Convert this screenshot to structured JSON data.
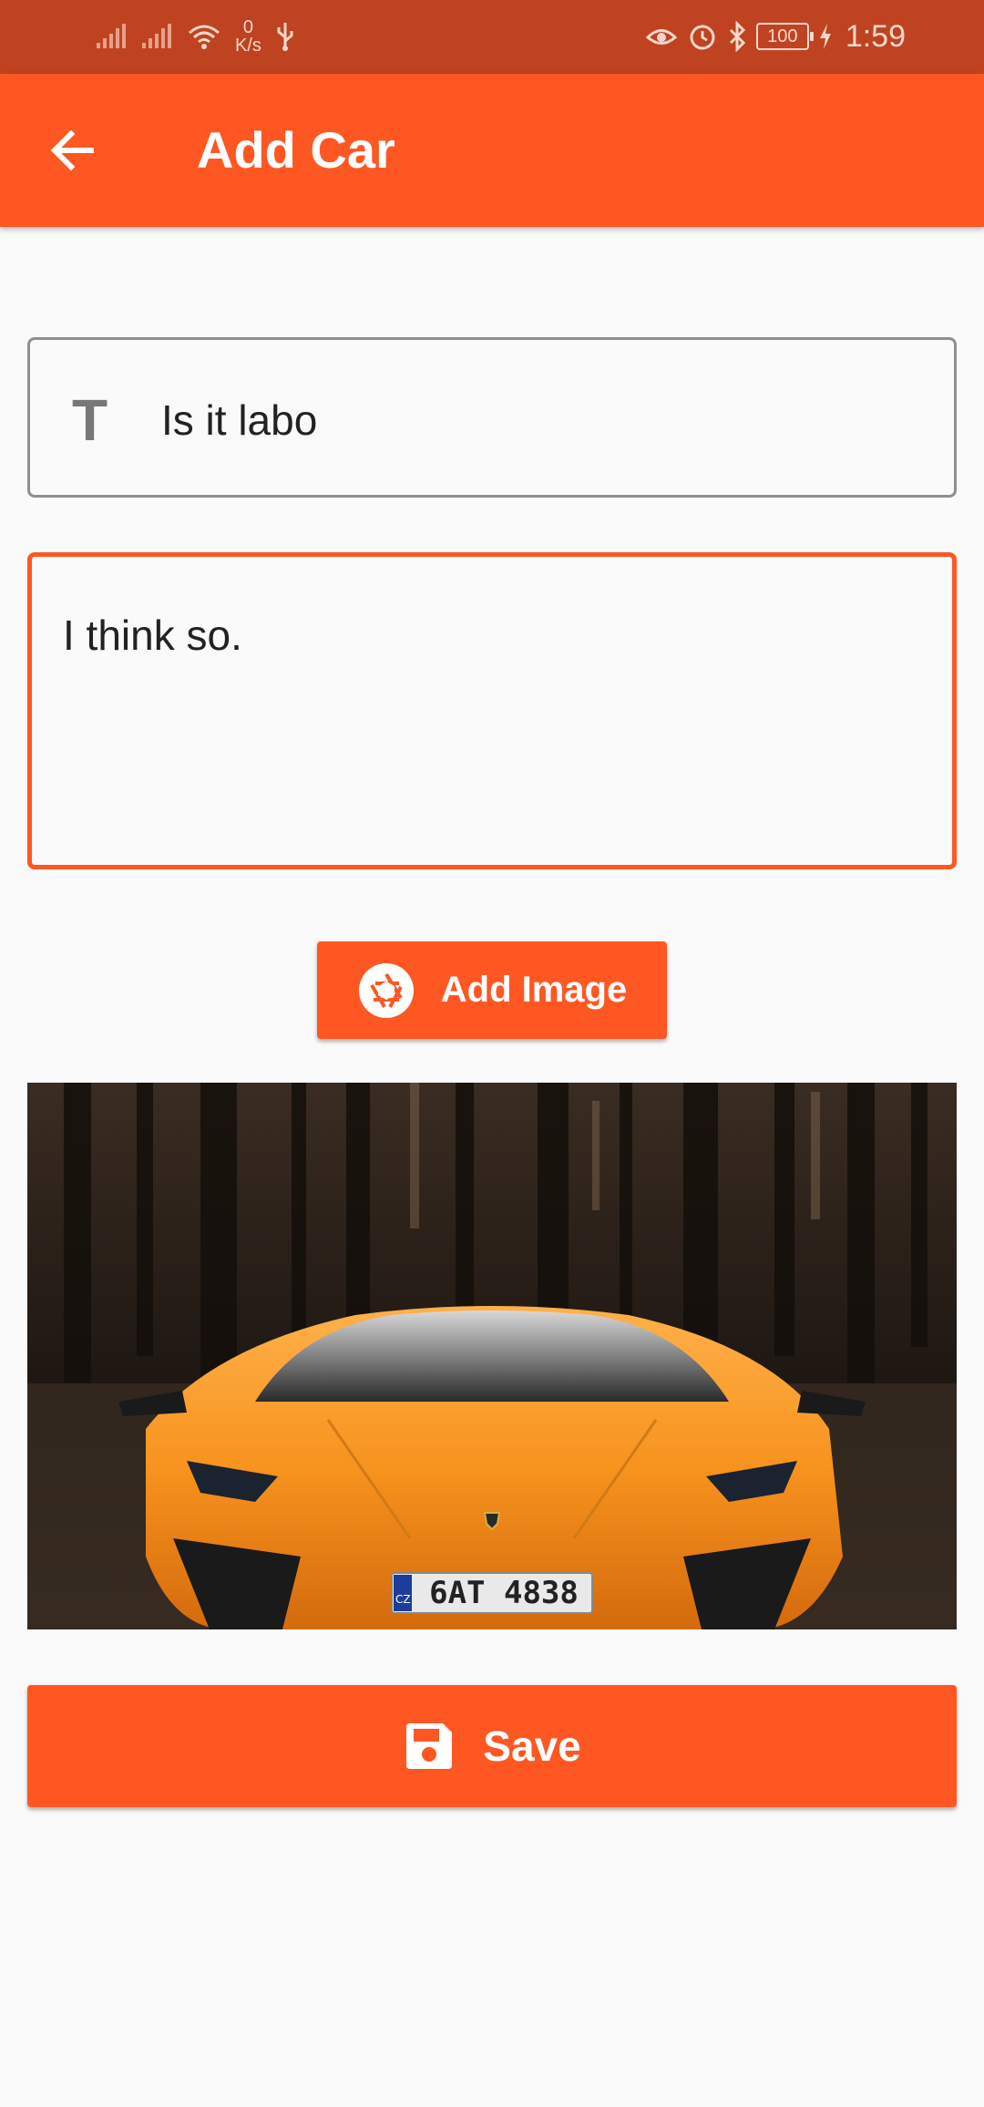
{
  "status_bar": {
    "speed_value": "0",
    "speed_unit": "K/s",
    "battery": "100",
    "time": "1:59"
  },
  "app_bar": {
    "title": "Add Car",
    "back_icon": "arrow-back-icon"
  },
  "form": {
    "title_field": {
      "icon": "title-icon",
      "icon_glyph": "T",
      "value": "Is it labo"
    },
    "description_field": {
      "value": "I think so."
    },
    "add_image_button": {
      "icon": "camera-shutter-icon",
      "label": "Add Image"
    },
    "photo": {
      "plate_text": "6AT 4838",
      "plate_country": "CZ"
    },
    "save_button": {
      "icon": "save-floppy-icon",
      "label": "Save"
    }
  },
  "colors": {
    "primary": "#ff5722",
    "status_bar": "#bf4320",
    "background": "#fafafa"
  }
}
